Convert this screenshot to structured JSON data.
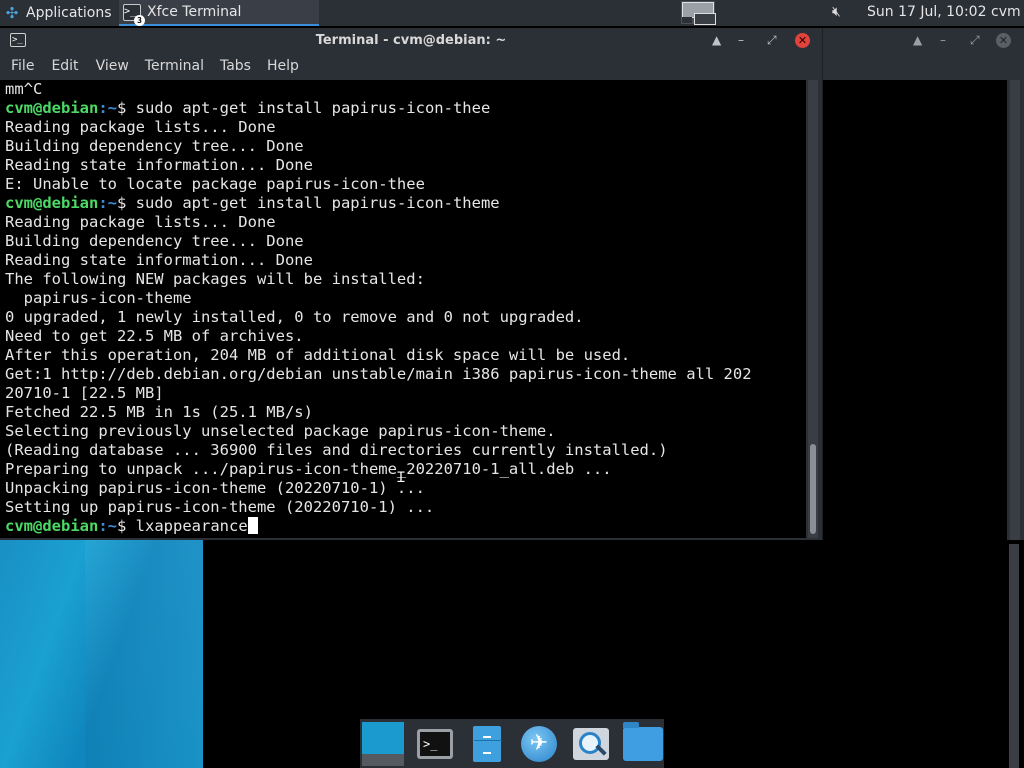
{
  "panel": {
    "apps_label": "Applications",
    "task_label": "Xfce Terminal",
    "task_badge": "3",
    "clock": "Sun 17 Jul, 10:02",
    "user": "cvm"
  },
  "window": {
    "title": "Terminal - cvm@debian: ~",
    "menu": [
      "File",
      "Edit",
      "View",
      "Terminal",
      "Tabs",
      "Help"
    ]
  },
  "terminal": {
    "prompt_user": "cvm@debian",
    "prompt_path": ":~",
    "prompt_symbol": "$",
    "lines": [
      {
        "text": "mm^C"
      },
      {
        "cmd": " sudo apt-get install papirus-icon-thee"
      },
      {
        "text": "Reading package lists... Done"
      },
      {
        "text": "Building dependency tree... Done"
      },
      {
        "text": "Reading state information... Done"
      },
      {
        "text": "E: Unable to locate package papirus-icon-thee"
      },
      {
        "cmd": " sudo apt-get install papirus-icon-theme"
      },
      {
        "text": "Reading package lists... Done"
      },
      {
        "text": "Building dependency tree... Done"
      },
      {
        "text": "Reading state information... Done"
      },
      {
        "text": "The following NEW packages will be installed:"
      },
      {
        "text": "  papirus-icon-theme"
      },
      {
        "text": "0 upgraded, 1 newly installed, 0 to remove and 0 not upgraded."
      },
      {
        "text": "Need to get 22.5 MB of archives."
      },
      {
        "text": "After this operation, 204 MB of additional disk space will be used."
      },
      {
        "text": "Get:1 http://deb.debian.org/debian unstable/main i386 papirus-icon-theme all 202"
      },
      {
        "text": "20710-1 [22.5 MB]"
      },
      {
        "text": "Fetched 22.5 MB in 1s (25.1 MB/s)"
      },
      {
        "text": "Selecting previously unselected package papirus-icon-theme."
      },
      {
        "text": "(Reading database ... 36900 files and directories currently installed.)"
      },
      {
        "text": "Preparing to unpack .../papirus-icon-theme_20220710-1_all.deb ..."
      },
      {
        "text": "Unpacking papirus-icon-theme (20220710-1) ..."
      },
      {
        "text": "Setting up papirus-icon-theme (20220710-1) ..."
      }
    ],
    "current_cmd": " lxappearance"
  },
  "dock": {
    "items": [
      "show-desktop-icon",
      "terminal-icon",
      "file-cabinet-icon",
      "web-browser-icon",
      "app-finder-icon",
      "folder-icon"
    ]
  },
  "colors": {
    "prompt_user": "#4cd965",
    "prompt_path": "#3b8ed8",
    "panel_bg": "#2b2f36",
    "close_button": "#e0433b"
  }
}
